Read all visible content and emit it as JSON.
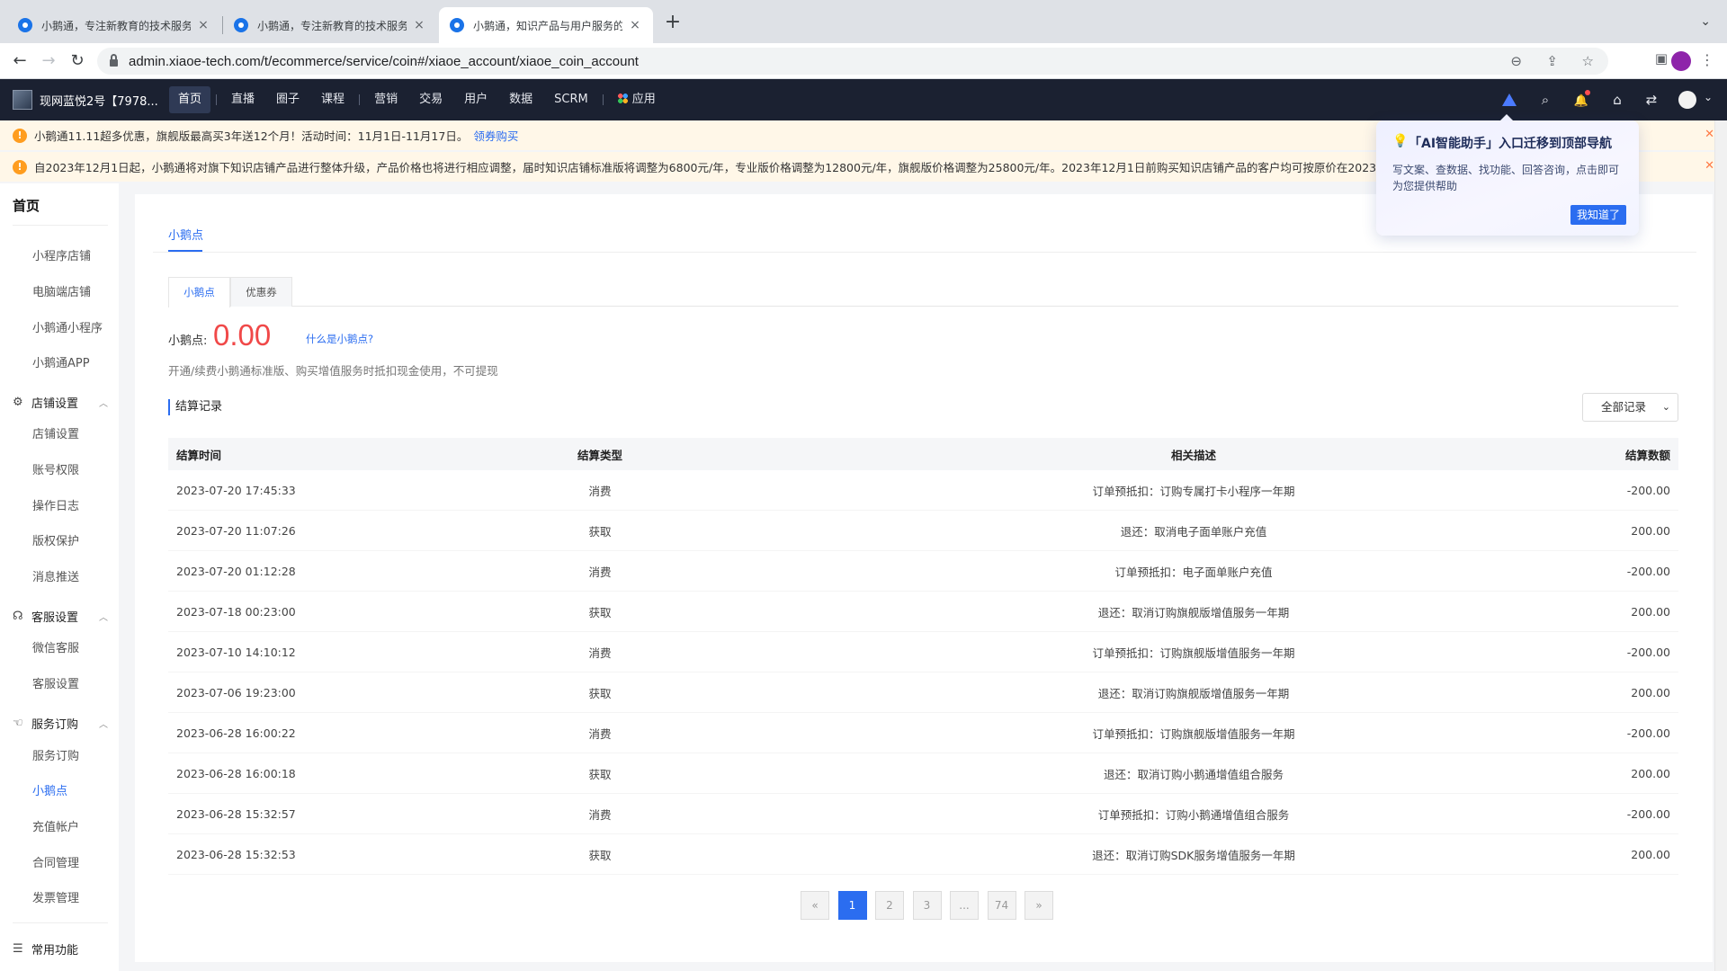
{
  "browser": {
    "tabs": [
      {
        "title": "小鹅通，专注新教育的技术服务商"
      },
      {
        "title": "小鹅通，专注新教育的技术服务商"
      },
      {
        "title": "小鹅通，知识产品与用户服务的"
      }
    ],
    "url": "admin.xiaoe-tech.com/t/ecommerce/service/coin#/xiaoe_account/xiaoe_coin_account",
    "icons": {
      "back": "←",
      "forward": "→",
      "reload": "↻",
      "new_tab": "+",
      "tab_close": "×",
      "tab_search": "⌄",
      "zoom": "⊖",
      "share": "⇪",
      "star": "☆",
      "side_panel": "▣",
      "menu": "⋮"
    }
  },
  "header": {
    "shop_name": "现网蓝悦2号【7978...",
    "nav": [
      "首页",
      "直播",
      "圈子",
      "课程",
      "营销",
      "交易",
      "用户",
      "数据",
      "SCRM"
    ],
    "apps_label": "应用",
    "icons": {
      "search": "⌕",
      "bell": "🔔",
      "store": "⌂",
      "switch": "⇄",
      "caret": "⌄"
    }
  },
  "notices": [
    {
      "text": "小鹅通11.11超多优惠，旗舰版最高买3年送12个月！活动时间：11月1日-11月17日。",
      "link": "领券购买"
    },
    {
      "text": "自2023年12月1日起，小鹅通将对旗下知识店铺产品进行整体升级，产品价格也将进行相应调整，届时知识店铺标准版将调整为6800元/年，专业版价格调整为12800元/年，旗舰版价格调整为25800元/年。2023年12月1日前购买知识店铺产品的客户均可按原价在2023年",
      "link": ""
    }
  ],
  "sidebar": {
    "home": "首页",
    "top_items": [
      "小程序店铺",
      "电脑端店铺",
      "小鹅通小程序",
      "小鹅通APP"
    ],
    "groups": [
      {
        "title": "店铺设置",
        "icon": "gear-icon",
        "glyph": "⚙",
        "items": [
          "店铺设置",
          "账号权限",
          "操作日志",
          "版权保护",
          "消息推送"
        ]
      },
      {
        "title": "客服设置",
        "icon": "headset-icon",
        "glyph": "☊",
        "items": [
          "微信客服",
          "客服设置"
        ]
      },
      {
        "title": "服务订购",
        "icon": "hand-icon",
        "glyph": "☜",
        "items": [
          "服务订购",
          "小鹅点",
          "充值帐户",
          "合同管理",
          "发票管理"
        ]
      }
    ],
    "active_item": "小鹅点",
    "bottom": {
      "title": "常用功能",
      "glyph": "☰"
    }
  },
  "main": {
    "page_tab": "小鹅点",
    "subtabs": [
      "小鹅点",
      "优惠券"
    ],
    "balance_label": "小鹅点:",
    "balance_value": "0.00",
    "what_link": "什么是小鹅点?",
    "description": "开通/续费小鹅通标准版、购买增值服务时抵扣现金使用，不可提现",
    "records_title": "结算记录",
    "filter_value": "全部记录",
    "table": {
      "headers": [
        "结算时间",
        "结算类型",
        "相关描述",
        "结算数额"
      ],
      "rows": [
        [
          "2023-07-20 17:45:33",
          "消费",
          "订单预抵扣：订购专属打卡小程序一年期",
          "-200.00"
        ],
        [
          "2023-07-20 11:07:26",
          "获取",
          "退还：取消电子面单账户充值",
          "200.00"
        ],
        [
          "2023-07-20 01:12:28",
          "消费",
          "订单预抵扣：电子面单账户充值",
          "-200.00"
        ],
        [
          "2023-07-18 00:23:00",
          "获取",
          "退还：取消订购旗舰版增值服务一年期",
          "200.00"
        ],
        [
          "2023-07-10 14:10:12",
          "消费",
          "订单预抵扣：订购旗舰版增值服务一年期",
          "-200.00"
        ],
        [
          "2023-07-06 19:23:00",
          "获取",
          "退还：取消订购旗舰版增值服务一年期",
          "200.00"
        ],
        [
          "2023-06-28 16:00:22",
          "消费",
          "订单预抵扣：订购旗舰版增值服务一年期",
          "-200.00"
        ],
        [
          "2023-06-28 16:00:18",
          "获取",
          "退还：取消订购小鹅通增值组合服务",
          "200.00"
        ],
        [
          "2023-06-28 15:32:57",
          "消费",
          "订单预抵扣：订购小鹅通增值组合服务",
          "-200.00"
        ],
        [
          "2023-06-28 15:32:53",
          "获取",
          "退还：取消订购SDK服务增值服务一年期",
          "200.00"
        ]
      ]
    },
    "pagination": [
      "«",
      "1",
      "2",
      "3",
      "...",
      "74",
      "»"
    ],
    "current_page": "1"
  },
  "ai_popover": {
    "title": "「AI智能助手」入口迁移到顶部导航",
    "body": "写文案、查数据、找功能、回答咨询，点击即可为您提供帮助",
    "button": "我知道了"
  },
  "colors": {
    "accent": "#2b6df0",
    "header_bg": "#1b2131",
    "balance": "#f04848",
    "notice_bg": "#fff7e8"
  }
}
